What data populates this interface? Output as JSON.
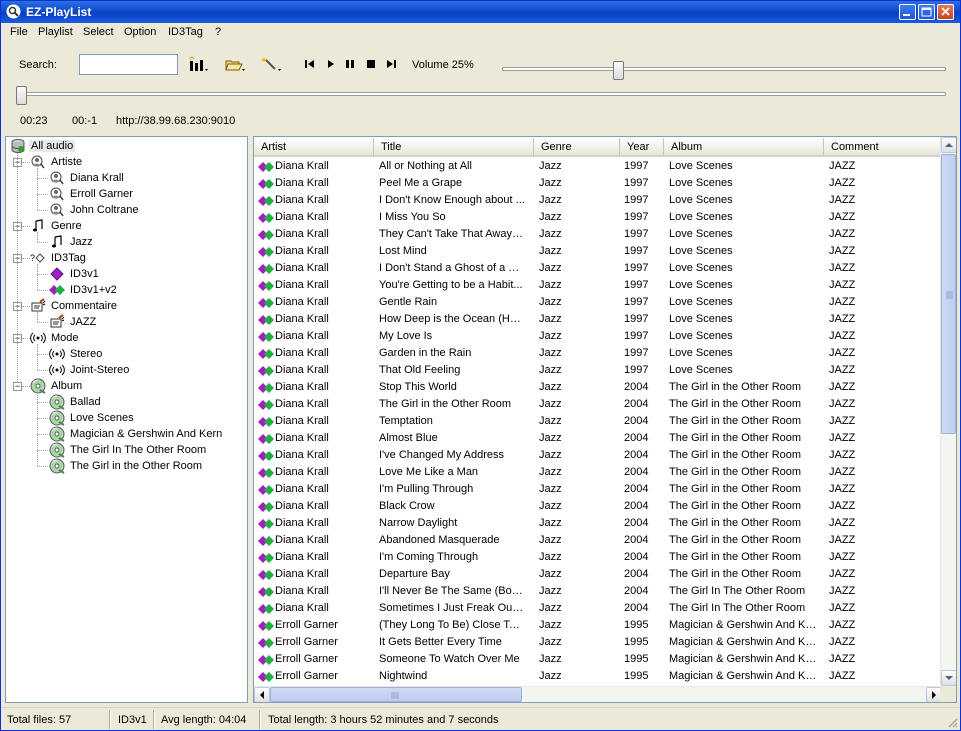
{
  "window": {
    "title": "EZ-PlayList"
  },
  "menu": [
    "File",
    "Playlist",
    "Select",
    "Option",
    "ID3Tag",
    "?"
  ],
  "toolbar": {
    "search_label": "Search:",
    "search_value": "",
    "volume_label": "Volume 25%",
    "volume_level": 0.25,
    "position_level": 0.0
  },
  "player": {
    "elapsed": "00:23",
    "remaining": "00:-1",
    "stream_url": "http://38.99.68.230:9010"
  },
  "tree": {
    "root": "All audio",
    "groups": [
      {
        "label": "Artiste",
        "icon": "artist-icon",
        "children": [
          "Diana Krall",
          "Erroll Garner",
          "John Coltrane"
        ]
      },
      {
        "label": "Genre",
        "icon": "music-note-icon",
        "children": [
          "Jazz"
        ]
      },
      {
        "label": "ID3Tag",
        "icon": "id3-tag-icon",
        "children": [
          "ID3v1",
          "ID3v1+v2"
        ]
      },
      {
        "label": "Commentaire",
        "icon": "comment-icon",
        "children": [
          "JAZZ"
        ]
      },
      {
        "label": "Mode",
        "icon": "stereo-icon",
        "children": [
          "Stereo",
          "Joint-Stereo"
        ]
      },
      {
        "label": "Album",
        "icon": "album-cd-icon",
        "children": [
          "Ballad",
          "Love Scenes",
          "Magician & Gershwin And Kern",
          "The Girl In The Other Room",
          "The Girl in the Other Room"
        ]
      }
    ]
  },
  "list": {
    "columns": [
      "Artist",
      "Title",
      "Genre",
      "Year",
      "Album",
      "Comment"
    ],
    "rows": [
      [
        "Diana Krall",
        "All or Nothing at All",
        "Jazz",
        "1997",
        "Love Scenes",
        "JAZZ"
      ],
      [
        "Diana Krall",
        "Peel Me a Grape",
        "Jazz",
        "1997",
        "Love Scenes",
        "JAZZ"
      ],
      [
        "Diana Krall",
        "I Don't Know Enough about ...",
        "Jazz",
        "1997",
        "Love Scenes",
        "JAZZ"
      ],
      [
        "Diana Krall",
        "I Miss You So",
        "Jazz",
        "1997",
        "Love Scenes",
        "JAZZ"
      ],
      [
        "Diana Krall",
        "They Can't Take That Away fr...",
        "Jazz",
        "1997",
        "Love Scenes",
        "JAZZ"
      ],
      [
        "Diana Krall",
        "Lost Mind",
        "Jazz",
        "1997",
        "Love Scenes",
        "JAZZ"
      ],
      [
        "Diana Krall",
        "I Don't Stand a Ghost of a C...",
        "Jazz",
        "1997",
        "Love Scenes",
        "JAZZ"
      ],
      [
        "Diana Krall",
        "You're Getting to be a Habit...",
        "Jazz",
        "1997",
        "Love Scenes",
        "JAZZ"
      ],
      [
        "Diana Krall",
        "Gentle Rain",
        "Jazz",
        "1997",
        "Love Scenes",
        "JAZZ"
      ],
      [
        "Diana Krall",
        "How Deep is the Ocean (Ho...",
        "Jazz",
        "1997",
        "Love Scenes",
        "JAZZ"
      ],
      [
        "Diana Krall",
        "My Love Is",
        "Jazz",
        "1997",
        "Love Scenes",
        "JAZZ"
      ],
      [
        "Diana Krall",
        "Garden in the Rain",
        "Jazz",
        "1997",
        "Love Scenes",
        "JAZZ"
      ],
      [
        "Diana Krall",
        "That Old Feeling",
        "Jazz",
        "1997",
        "Love Scenes",
        "JAZZ"
      ],
      [
        "Diana Krall",
        "Stop This World",
        "Jazz",
        "2004",
        "The Girl in the Other Room",
        "JAZZ"
      ],
      [
        "Diana Krall",
        "The Girl in the Other Room",
        "Jazz",
        "2004",
        "The Girl in the Other Room",
        "JAZZ"
      ],
      [
        "Diana Krall",
        "Temptation",
        "Jazz",
        "2004",
        "The Girl in the Other Room",
        "JAZZ"
      ],
      [
        "Diana Krall",
        "Almost Blue",
        "Jazz",
        "2004",
        "The Girl in the Other Room",
        "JAZZ"
      ],
      [
        "Diana Krall",
        "I've Changed My Address",
        "Jazz",
        "2004",
        "The Girl in the Other Room",
        "JAZZ"
      ],
      [
        "Diana Krall",
        "Love Me Like a Man",
        "Jazz",
        "2004",
        "The Girl in the Other Room",
        "JAZZ"
      ],
      [
        "Diana Krall",
        "I'm Pulling Through",
        "Jazz",
        "2004",
        "The Girl in the Other Room",
        "JAZZ"
      ],
      [
        "Diana Krall",
        "Black Crow",
        "Jazz",
        "2004",
        "The Girl in the Other Room",
        "JAZZ"
      ],
      [
        "Diana Krall",
        "Narrow Daylight",
        "Jazz",
        "2004",
        "The Girl in the Other Room",
        "JAZZ"
      ],
      [
        "Diana Krall",
        "Abandoned Masquerade",
        "Jazz",
        "2004",
        "The Girl in the Other Room",
        "JAZZ"
      ],
      [
        "Diana Krall",
        "I'm Coming Through",
        "Jazz",
        "2004",
        "The Girl in the Other Room",
        "JAZZ"
      ],
      [
        "Diana Krall",
        "Departure Bay",
        "Jazz",
        "2004",
        "The Girl in the Other Room",
        "JAZZ"
      ],
      [
        "Diana Krall",
        "I'll Never Be The Same (Bonus",
        "Jazz",
        "2004",
        "The Girl In The Other Room",
        "JAZZ"
      ],
      [
        "Diana Krall",
        "Sometimes I Just Freak Out (Bo",
        "Jazz",
        "2004",
        "The Girl In The Other Room",
        "JAZZ"
      ],
      [
        "Erroll Garner",
        "(They Long To Be) Close To ...",
        "Jazz",
        "1995",
        "Magician & Gershwin And Kern",
        "JAZZ"
      ],
      [
        "Erroll Garner",
        "It Gets Better Every Time",
        "Jazz",
        "1995",
        "Magician & Gershwin And Kern",
        "JAZZ"
      ],
      [
        "Erroll Garner",
        "Someone To Watch Over Me",
        "Jazz",
        "1995",
        "Magician & Gershwin And Kern",
        "JAZZ"
      ],
      [
        "Erroll Garner",
        "Nightwind",
        "Jazz",
        "1995",
        "Magician & Gershwin And Kern",
        "JAZZ"
      ]
    ]
  },
  "status": {
    "total_files": "Total files: 57",
    "tag": "ID3v1",
    "avg_length": "Avg length: 04:04",
    "total_length": "Total length:  3 hours 52 minutes and  7 seconds"
  },
  "colors": {
    "titlebar": "#0a4ad0",
    "chrome": "#ece9d8",
    "tag_purple": "#a020c0",
    "tag_green": "#20b040"
  }
}
